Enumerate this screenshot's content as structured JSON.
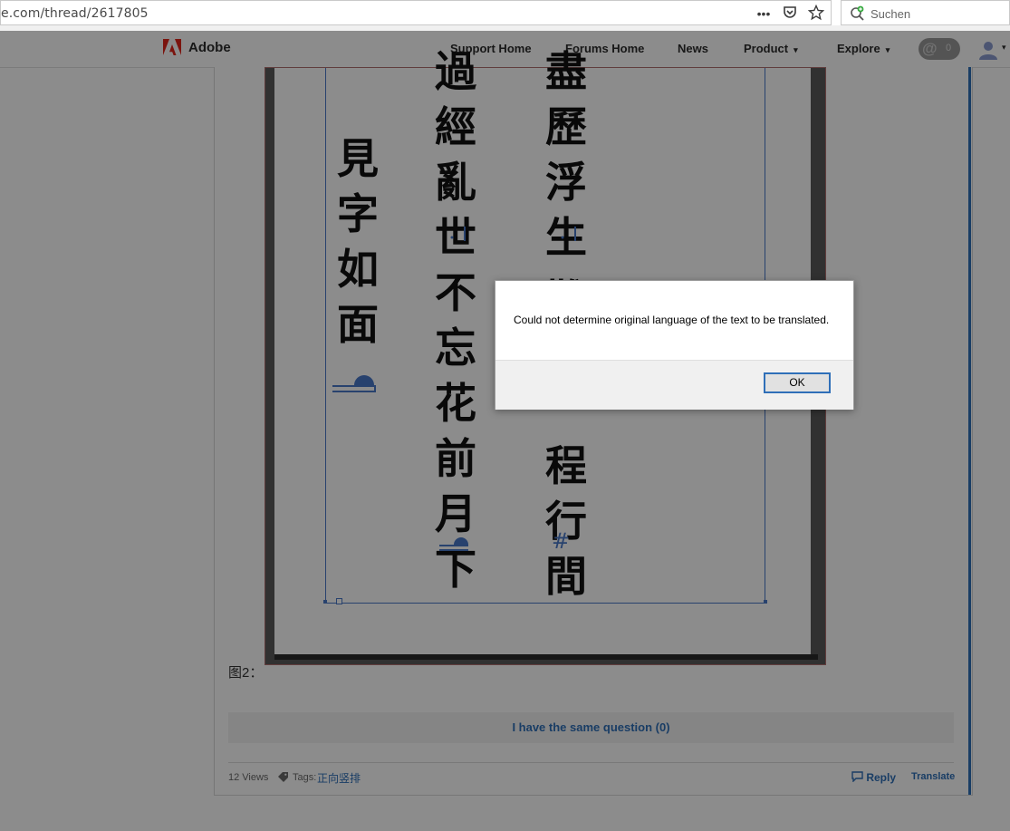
{
  "browser": {
    "url": "e.com/thread/2617805",
    "search_placeholder": "Suchen",
    "more_icon": "more-dots-icon",
    "pocket_icon": "pocket-icon",
    "bookmark_icon": "star-icon"
  },
  "nav": {
    "brand": "Adobe",
    "items": [
      {
        "label": "Support Home"
      },
      {
        "label": "Forums Home"
      },
      {
        "label": "News"
      },
      {
        "label": "Product",
        "caret": "▾"
      },
      {
        "label": "Explore",
        "caret": "▾"
      }
    ],
    "notification_count": "0",
    "at_symbol": "@"
  },
  "document": {
    "col_left": [
      "見",
      "字",
      "如",
      "面"
    ],
    "col_middle": [
      "過",
      "經",
      "亂",
      "世",
      "不",
      "忘",
      "花",
      "前",
      "月",
      "下"
    ],
    "col_right": [
      "盡",
      "歷",
      "浮",
      "生",
      "難",
      "程",
      "行",
      "間"
    ],
    "hash_mark": "#"
  },
  "post": {
    "caption": "图2：",
    "same_question": "I have the same question (0)",
    "views": "12 Views",
    "tags_label": "Tags:",
    "tag": "正向竖排",
    "reply": "Reply",
    "translate": "Translate"
  },
  "dialog": {
    "message": "Could not determine original language of the text to be translated.",
    "ok": "OK"
  },
  "colors": {
    "accent": "#2f6fb8",
    "adobe_red": "#e1251b",
    "frame_blue": "#4a78c8"
  }
}
